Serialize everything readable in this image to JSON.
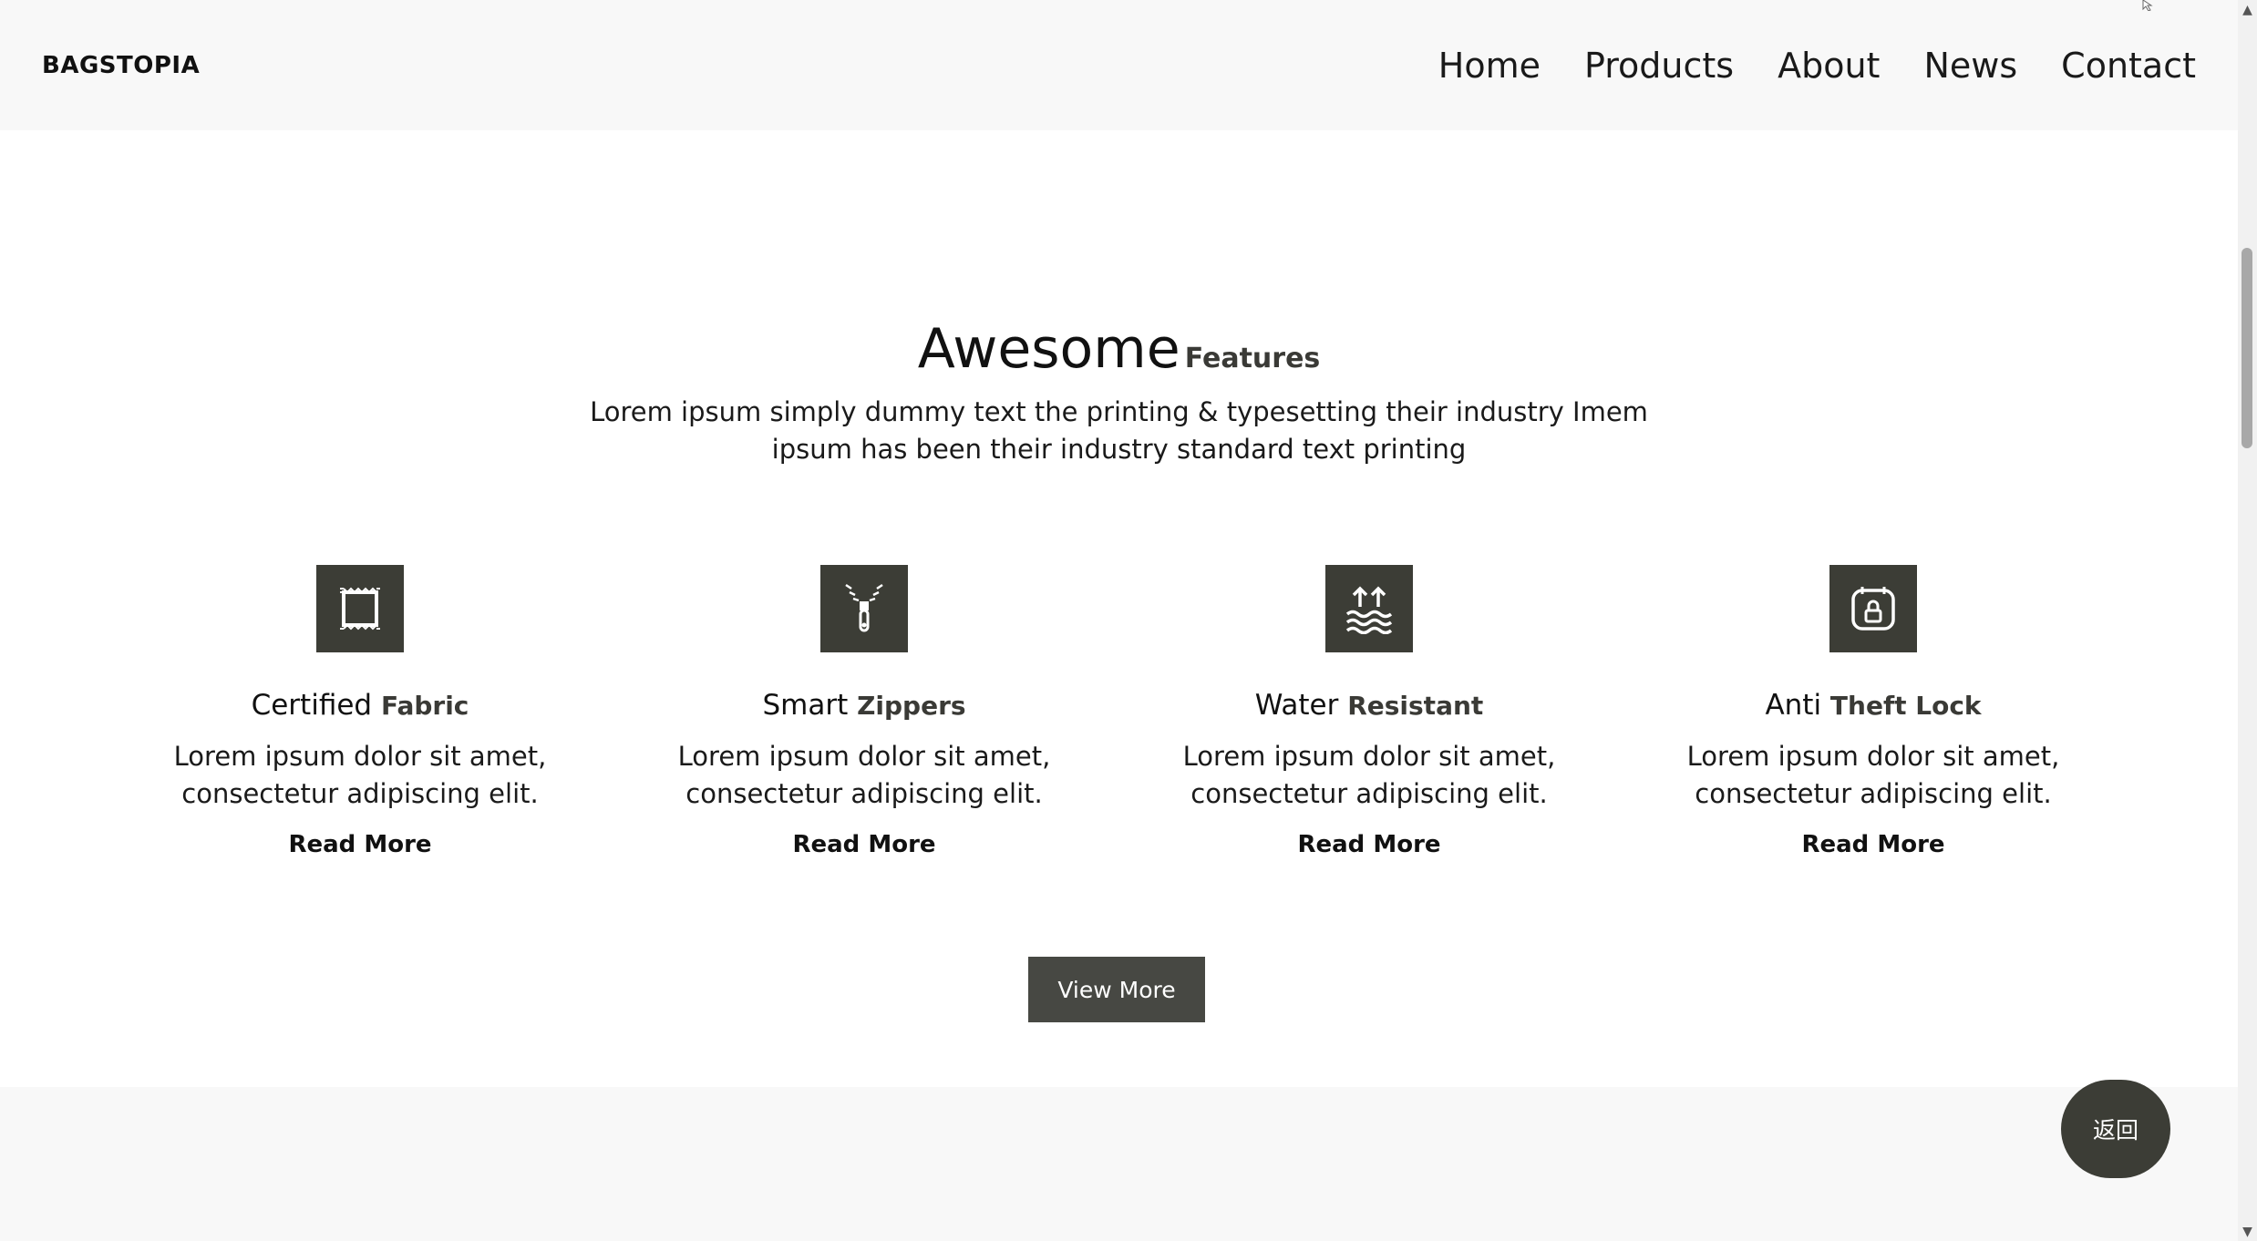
{
  "header": {
    "brand": "BAGSTOPIA",
    "nav": [
      "Home",
      "Products",
      "About",
      "News",
      "Contact"
    ]
  },
  "features_section": {
    "title_main": "Awesome",
    "title_sub": "Features",
    "description": "Lorem ipsum simply dummy text the printing & typesetting their industry Imem ipsum has been their industry standard text printing",
    "items": [
      {
        "title": "Certified",
        "accent": "Fabric",
        "text": "Lorem ipsum dolor sit amet, consectetur adipiscing elit.",
        "link": "Read More",
        "icon": "fabric-icon"
      },
      {
        "title": "Smart",
        "accent": "Zippers",
        "text": "Lorem ipsum dolor sit amet, consectetur adipiscing elit.",
        "link": "Read More",
        "icon": "zipper-icon"
      },
      {
        "title": "Water",
        "accent": "Resistant",
        "text": "Lorem ipsum dolor sit amet, consectetur adipiscing elit.",
        "link": "Read More",
        "icon": "water-resistant-icon"
      },
      {
        "title": "Anti",
        "accent": "Theft Lock",
        "text": "Lorem ipsum dolor sit amet, consectetur adipiscing elit.",
        "link": "Read More",
        "icon": "lock-icon"
      }
    ],
    "view_more": "View More"
  },
  "back_button": "返回",
  "colors": {
    "icon_bg": "#3c3d36",
    "button_bg": "#474843",
    "header_bg": "#f8f8f8"
  }
}
